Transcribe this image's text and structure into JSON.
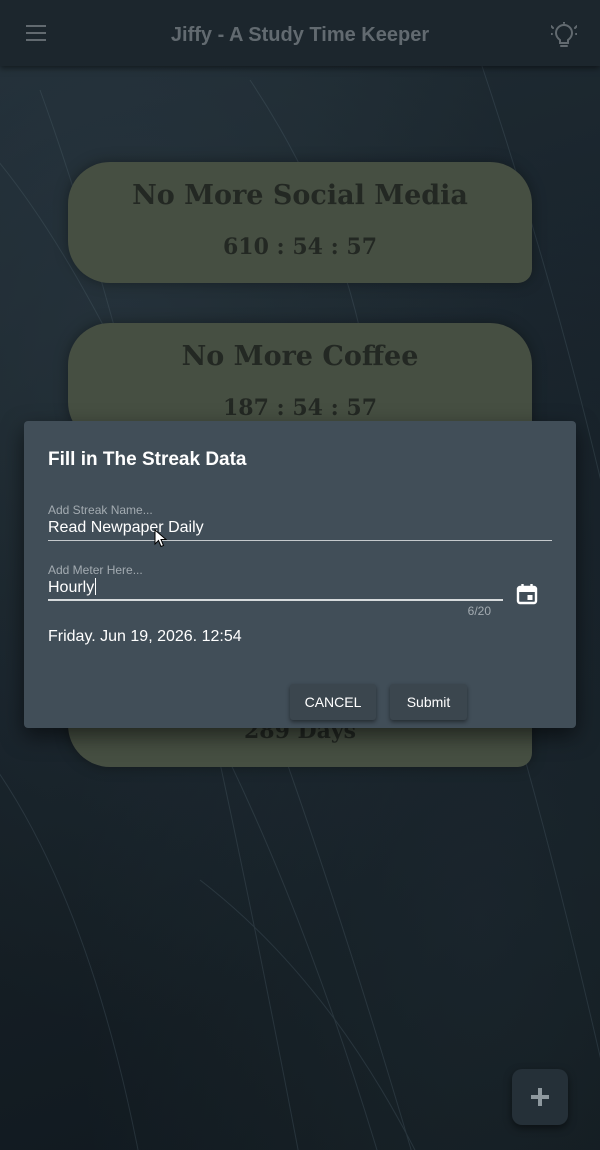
{
  "app": {
    "title": "Jiffy - A Study Time Keeper",
    "menu_icon": "hamburger-menu-icon",
    "theme_icon": "lightbulb-icon"
  },
  "streaks": [
    {
      "title": "No More Social Media",
      "timer": "610 : 54 : 57"
    },
    {
      "title": "No More Coffee",
      "timer": "187 : 54 : 57"
    },
    {
      "title": "",
      "timer": "289 Days"
    }
  ],
  "dialog": {
    "title": "Fill in The Streak Data",
    "name_field": {
      "label": "Add Streak Name...",
      "value": "Read Newpaper Daily"
    },
    "meter_field": {
      "label": "Add Meter Here...",
      "value": "Hourly",
      "counter": "6/20"
    },
    "calendar_icon": "calendar-icon",
    "date": "Friday. Jun 19, 2026. 12:54",
    "cancel_label": "CANCEL",
    "submit_label": "Submit"
  },
  "fab": {
    "icon": "plus-icon"
  },
  "colors": {
    "appbar": "#1f2a31",
    "card": "#4d5648",
    "dialog": "#414e58",
    "button": "#3b464e",
    "fab": "#253038"
  }
}
